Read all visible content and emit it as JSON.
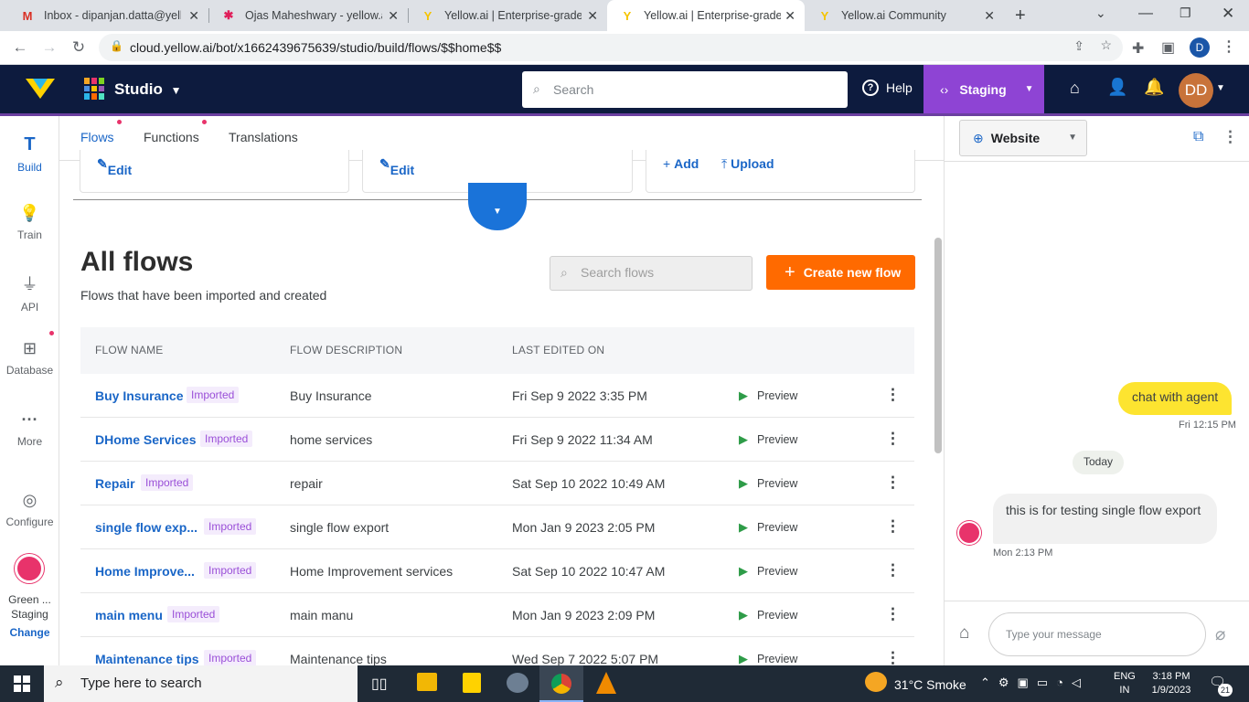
{
  "browser": {
    "tabs": [
      {
        "title": "Inbox - dipanjan.datta@yello",
        "favicon": "gmail-icon"
      },
      {
        "title": "Ojas Maheshwary - yellow.ai",
        "favicon": "slack-icon"
      },
      {
        "title": "Yellow.ai | Enterprise-grade C",
        "favicon": "yellow-ai-icon"
      },
      {
        "title": "Yellow.ai | Enterprise-grade C",
        "favicon": "yellow-ai-icon"
      },
      {
        "title": "Yellow.ai Community",
        "favicon": "yellow-ai-icon"
      }
    ],
    "url": "cloud.yellow.ai/bot/x1662439675639/studio/build/flows/$$home$$",
    "profile_initial": "D"
  },
  "header": {
    "app_name": "Studio",
    "search_placeholder": "Search",
    "help_label": "Help",
    "env_label": "Staging",
    "avatar_initials": "DD"
  },
  "rail": {
    "items": [
      {
        "label": "Build",
        "icon": "build-icon"
      },
      {
        "label": "Train",
        "icon": "bulb-icon"
      },
      {
        "label": "API",
        "icon": "plug-icon"
      },
      {
        "label": "Database",
        "icon": "table-icon"
      },
      {
        "label": "More",
        "icon": "more-icon"
      },
      {
        "label": "Configure",
        "icon": "configure-icon"
      }
    ],
    "bot_name": "Green ...",
    "bot_env": "Staging",
    "change_label": "Change"
  },
  "subnav": {
    "tabs": [
      "Flows",
      "Functions",
      "Translations"
    ]
  },
  "cards": {
    "edit1": "Edit",
    "edit2": "Edit",
    "add": "Add",
    "upload": "Upload"
  },
  "flows": {
    "title": "All flows",
    "subtitle": "Flows that have been imported and created",
    "search_placeholder": "Search flows",
    "create_label": "Create new flow",
    "columns": [
      "FLOW NAME",
      "FLOW DESCRIPTION",
      "LAST EDITED ON"
    ],
    "rows": [
      {
        "name": "Buy Insurance",
        "badge": "Imported",
        "desc": "Buy Insurance",
        "edited": "Fri Sep 9 2022 3:35 PM",
        "preview": "Preview"
      },
      {
        "name": "DHome Services",
        "badge": "Imported",
        "desc": "home services",
        "edited": "Fri Sep 9 2022 11:34 AM",
        "preview": "Preview"
      },
      {
        "name": "Repair",
        "badge": "Imported",
        "desc": "repair",
        "edited": "Sat Sep 10 2022 10:49 AM",
        "preview": "Preview"
      },
      {
        "name": "single flow exp...",
        "badge": "Imported",
        "desc": "single flow export",
        "edited": "Mon Jan 9 2023 2:05 PM",
        "preview": "Preview"
      },
      {
        "name": "Home Improve...",
        "badge": "Imported",
        "desc": "Home Improvement services",
        "edited": "Sat Sep 10 2022 10:47 AM",
        "preview": "Preview"
      },
      {
        "name": "main menu",
        "badge": "Imported",
        "desc": "main manu",
        "edited": "Mon Jan 9 2023 2:09 PM",
        "preview": "Preview"
      },
      {
        "name": "Maintenance tips",
        "badge": "Imported",
        "desc": "Maintenance tips",
        "edited": "Wed Sep 7 2022 5:07 PM",
        "preview": "Preview"
      }
    ]
  },
  "chat": {
    "channel": "Website",
    "messages": [
      {
        "from": "user",
        "text": "chat with agent",
        "time": "Fri 12:15 PM"
      },
      {
        "divider": "Today"
      },
      {
        "from": "bot",
        "text": "this is for testing single flow export",
        "time": "Mon 2:13 PM"
      }
    ],
    "input_placeholder": "Type your message"
  },
  "taskbar": {
    "search_placeholder": "Type here to search",
    "weather": "31°C  Smoke",
    "lang1": "ENG",
    "lang2": "IN",
    "time": "3:18 PM",
    "date": "1/9/2023",
    "notif_count": "21"
  },
  "colors": {
    "header_bg": "#0d1b3e",
    "staging": "#8e44d4",
    "accent": "#ff6a00",
    "link": "#1a66c7"
  }
}
